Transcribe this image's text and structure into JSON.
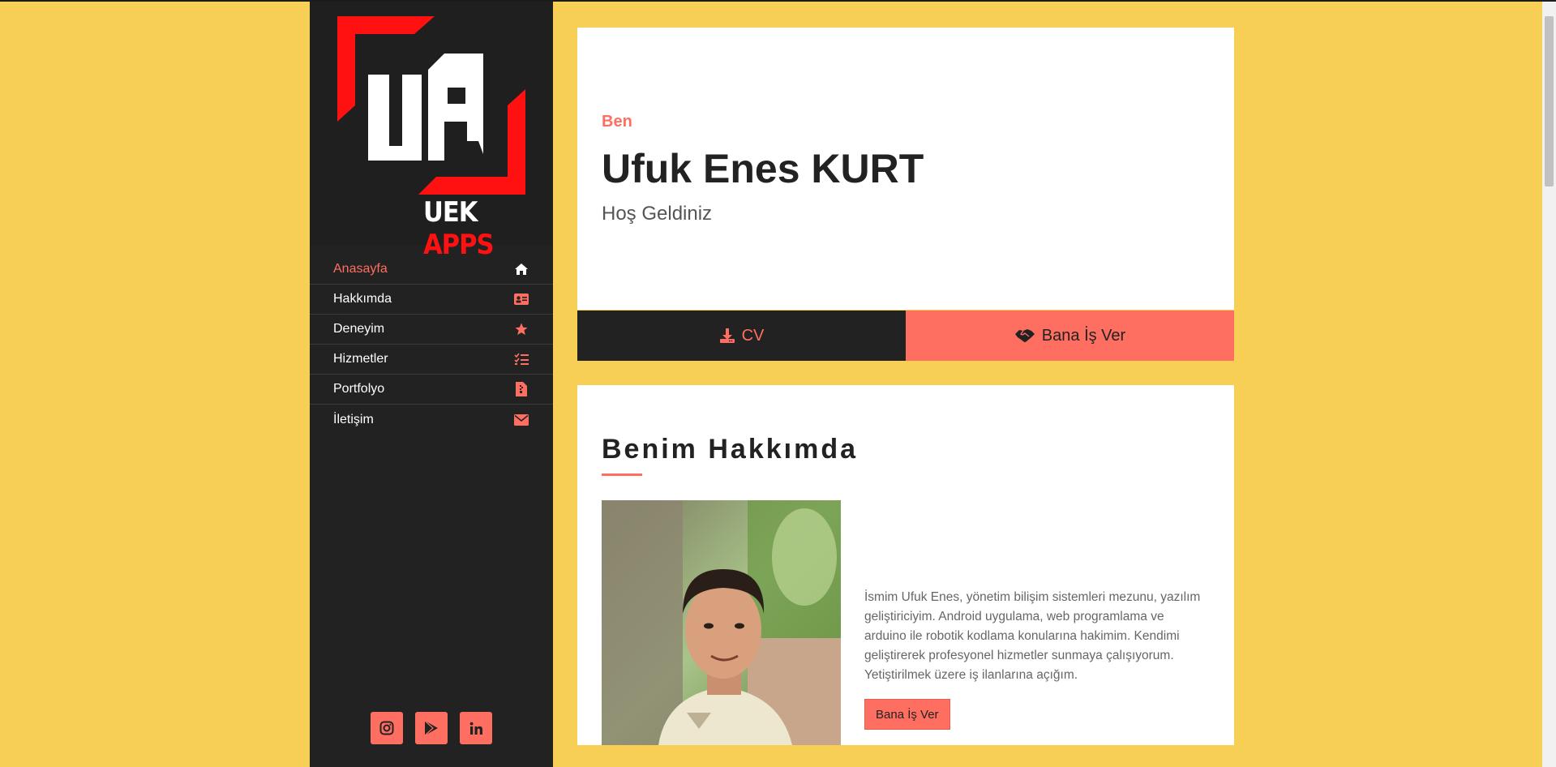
{
  "logo": {
    "mark": "UA",
    "brand_left": "UEK",
    "brand_right": "APPS"
  },
  "nav": [
    {
      "label": "Anasayfa",
      "icon": "home-icon",
      "active": true
    },
    {
      "label": "Hakkımda",
      "icon": "id-card-icon",
      "active": false
    },
    {
      "label": "Deneyim",
      "icon": "star-icon",
      "active": false
    },
    {
      "label": "Hizmetler",
      "icon": "tasks-icon",
      "active": false
    },
    {
      "label": "Portfolyo",
      "icon": "file-icon",
      "active": false
    },
    {
      "label": "İletişim",
      "icon": "envelope-icon",
      "active": false
    }
  ],
  "socials": [
    "instagram-icon",
    "google-play-icon",
    "linkedin-icon"
  ],
  "hero": {
    "eyebrow": "Ben",
    "name": "Ufuk Enes KURT",
    "subtitle": "Hoş Geldiniz",
    "cv_label": "CV",
    "hire_label": "Bana İş Ver"
  },
  "about": {
    "title": "Benim Hakkımda",
    "text": "İsmim Ufuk Enes, yönetim bilişim sistemleri mezunu, yazılım geliştiriciyim. Android uygulama, web programlama ve arduino ile robotik kodlama konularına hakimim. Kendimi geliştirerek profesyonel hizmetler sunmaya çalışıyorum. Yetiştirilmek üzere iş ilanlarına açığım.",
    "button_label": "Bana İş Ver"
  },
  "colors": {
    "accent": "#ff6f61",
    "background": "#f7cf55",
    "sidebar": "#222222"
  }
}
